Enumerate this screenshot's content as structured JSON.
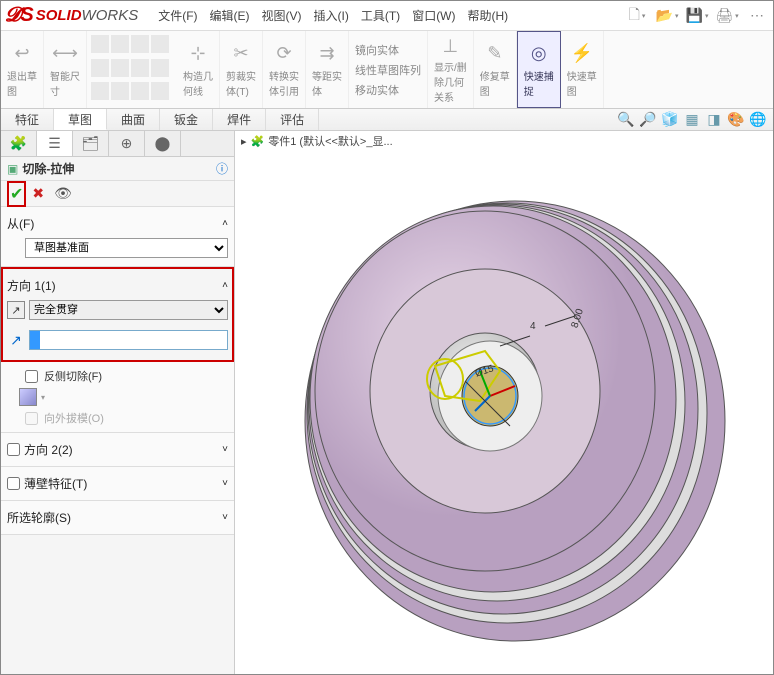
{
  "app": {
    "name_solid": "SOLID",
    "name_works": "WORKS"
  },
  "menu": {
    "file": "文件(F)",
    "edit": "编辑(E)",
    "view": "视图(V)",
    "insert": "插入(I)",
    "tools": "工具(T)",
    "window": "窗口(W)",
    "help": "帮助(H)"
  },
  "ribbon": {
    "exit_sketch": "退出草\n图",
    "smart_dim": "智能尺\n寸",
    "transform": "构造几\n何线",
    "trim": "剪裁实\n体(T)",
    "convert": "转换实\n体引用",
    "offset": "等距实\n体",
    "mirror": "镜向实体",
    "array": "线性草图阵列",
    "move": "移动实体",
    "display": "显示/删\n除几何\n关系",
    "repair": "修复草\n图",
    "quick_snap": "快速捕\n捉",
    "rapid_sketch": "快速草\n图"
  },
  "tabs": {
    "feature": "特征",
    "sketch": "草图",
    "surface": "曲面",
    "sheet": "钣金",
    "weld": "焊件",
    "eval": "评估"
  },
  "breadcrumb": {
    "part": "零件1  (默认<<默认>_显..."
  },
  "panel": {
    "title": "切除-拉伸",
    "from": {
      "label": "从(F)",
      "value": "草图基准面"
    },
    "dir1": {
      "label": "方向 1(1)",
      "end_condition": "完全贯穿"
    },
    "reverse_cut": "反侧切除(F)",
    "draft": "向外拔模(O)",
    "dir2": "方向 2(2)",
    "thin": "薄壁特征(T)",
    "contours": "所选轮廓(S)"
  },
  "dims": {
    "d1": "4",
    "d2": "8.00",
    "d3": "Ø15"
  }
}
